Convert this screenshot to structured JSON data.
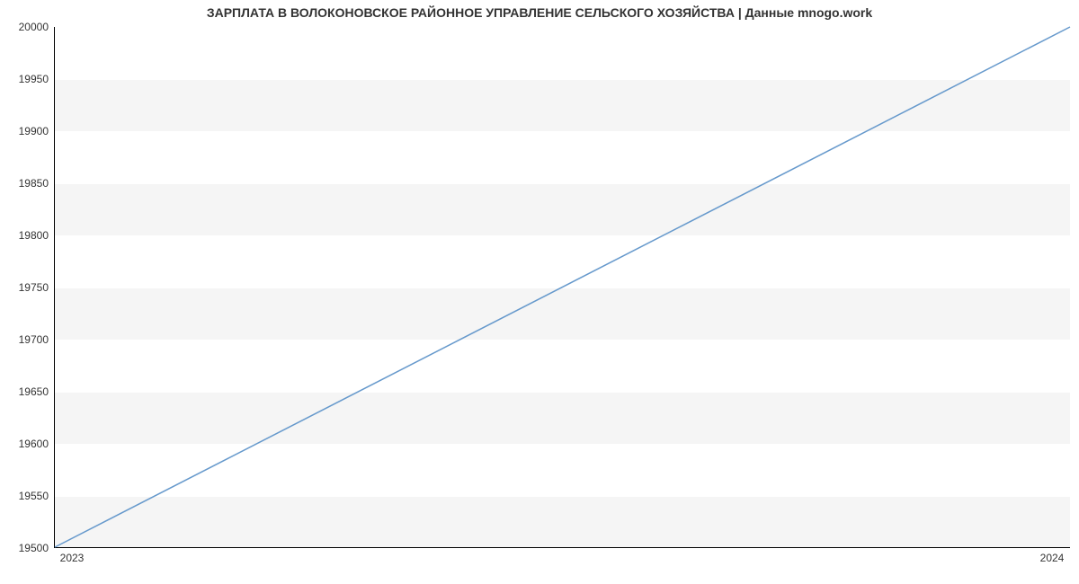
{
  "chart_data": {
    "type": "line",
    "title": "ЗАРПЛАТА В ВОЛОКОНОВСКОЕ РАЙОННОЕ УПРАВЛЕНИЕ СЕЛЬСКОГО ХОЗЯЙСТВА | Данные mnogo.work",
    "x": [
      "2023",
      "2024"
    ],
    "values": [
      19500,
      20000
    ],
    "xlabel": "",
    "ylabel": "",
    "ylim": [
      19500,
      20000
    ],
    "yticks": [
      19500,
      19550,
      19600,
      19650,
      19700,
      19750,
      19800,
      19850,
      19900,
      19950,
      20000
    ],
    "xticks": [
      "2023",
      "2024"
    ],
    "line_color": "#6699cc",
    "grid_band_color": "#ffffff",
    "plot_bg": "#f5f5f5"
  }
}
